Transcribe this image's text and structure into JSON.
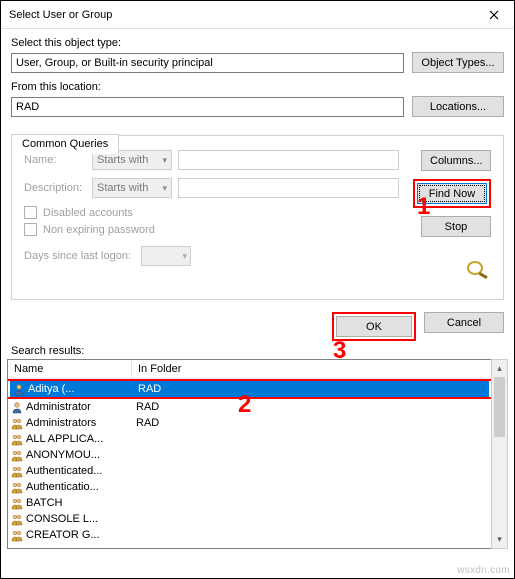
{
  "window": {
    "title": "Select User or Group"
  },
  "labels": {
    "object_type_label": "Select this object type:",
    "from_location_label": "From this location:",
    "common_queries_tab": "Common Queries",
    "name_label": "Name:",
    "desc_label": "Description:",
    "starts_with": "Starts with",
    "disabled_accounts": "Disabled accounts",
    "non_expiring": "Non expiring password",
    "days_since": "Days since last logon:",
    "search_results": "Search results:",
    "col_name": "Name",
    "col_folder": "In Folder"
  },
  "fields": {
    "object_type_value": "User, Group, or Built-in security principal",
    "location_value": "RAD"
  },
  "buttons": {
    "object_types": "Object Types...",
    "locations": "Locations...",
    "columns": "Columns...",
    "find_now": "Find Now",
    "stop": "Stop",
    "ok": "OK",
    "cancel": "Cancel"
  },
  "annotations": {
    "one": "1",
    "two": "2",
    "three": "3"
  },
  "results": [
    {
      "name": "Aditya      (...",
      "folder": "RAD",
      "icon": "user",
      "selected": true
    },
    {
      "name": "Administrator",
      "folder": "RAD",
      "icon": "user",
      "selected": false
    },
    {
      "name": "Administrators",
      "folder": "RAD",
      "icon": "group",
      "selected": false
    },
    {
      "name": "ALL APPLICA...",
      "folder": "",
      "icon": "group",
      "selected": false
    },
    {
      "name": "ANONYMOU...",
      "folder": "",
      "icon": "group",
      "selected": false
    },
    {
      "name": "Authenticated...",
      "folder": "",
      "icon": "group",
      "selected": false
    },
    {
      "name": "Authenticatio...",
      "folder": "",
      "icon": "group",
      "selected": false
    },
    {
      "name": "BATCH",
      "folder": "",
      "icon": "group",
      "selected": false
    },
    {
      "name": "CONSOLE L...",
      "folder": "",
      "icon": "group",
      "selected": false
    },
    {
      "name": "CREATOR G...",
      "folder": "",
      "icon": "group",
      "selected": false
    }
  ],
  "watermark": "wsxdn.com"
}
